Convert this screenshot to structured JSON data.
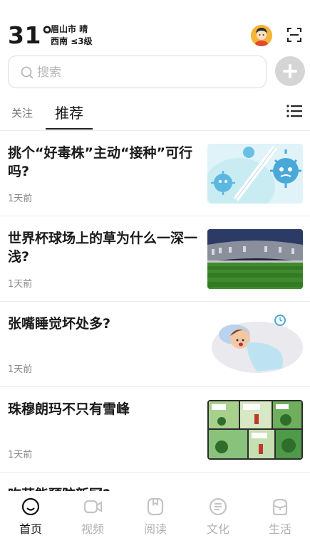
{
  "header": {
    "temperature": "31°",
    "city_weather": "眉山市 晴",
    "wind": "西南 ≤3级"
  },
  "search": {
    "placeholder": "搜索"
  },
  "tabs": {
    "follow": "关注",
    "recommend": "推荐"
  },
  "articles": [
    {
      "title": "挑个“好毒株”主动“接种”可行吗?",
      "time": "1天前",
      "thumb": "virus-illustration"
    },
    {
      "title": "世界杯球场上的草为什么一深一浅?",
      "time": "1天前",
      "thumb": "stadium-photo"
    },
    {
      "title": "张嘴睡觉坏处多?",
      "time": "1天前",
      "thumb": "sleeping-child-illustration"
    },
    {
      "title": "珠穆朗玛不只有雪峰",
      "time": "1天前",
      "thumb": "comic-strip"
    },
    {
      "title": "吃蒜能预防新冠?"
    }
  ],
  "bottom_nav": {
    "home": "首页",
    "video": "视频",
    "read": "阅读",
    "culture": "文化",
    "life": "生活"
  },
  "colors": {
    "accent_text": "#111111",
    "inactive": "#b0b0b0",
    "divider": "#ececec"
  }
}
